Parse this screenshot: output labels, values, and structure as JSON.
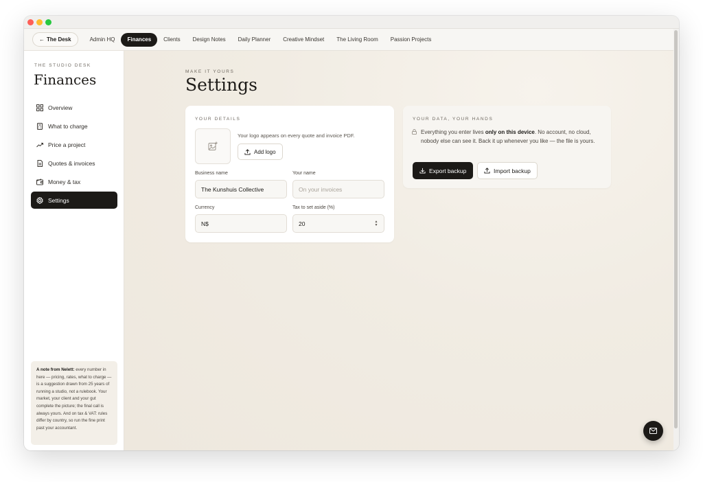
{
  "topnav": {
    "back_label": "The Desk",
    "tabs": [
      {
        "label": "Admin HQ",
        "active": false
      },
      {
        "label": "Finances",
        "active": true
      },
      {
        "label": "Clients",
        "active": false
      },
      {
        "label": "Design Notes",
        "active": false
      },
      {
        "label": "Daily Planner",
        "active": false
      },
      {
        "label": "Creative Mindset",
        "active": false
      },
      {
        "label": "The Living Room",
        "active": false
      },
      {
        "label": "Passion Projects",
        "active": false
      }
    ]
  },
  "sidebar": {
    "eyebrow": "THE STUDIO DESK",
    "title": "Finances",
    "items": [
      {
        "label": "Overview",
        "icon": "grid-icon"
      },
      {
        "label": "What to charge",
        "icon": "calculator-icon"
      },
      {
        "label": "Price a project",
        "icon": "trend-up-icon"
      },
      {
        "label": "Quotes & invoices",
        "icon": "document-icon"
      },
      {
        "label": "Money & tax",
        "icon": "wallet-icon"
      },
      {
        "label": "Settings",
        "icon": "gear-icon",
        "active": true
      }
    ],
    "note": {
      "author": "A note from Nelett:",
      "text": " every number in here — pricing, rates, what to charge — is a suggestion drawn from 25 years of running a studio, not a rulebook. Your market, your client and your gut complete the picture; the final call is always yours. And on tax & VAT: rules differ by country, so run the fine print past your accountant."
    }
  },
  "main": {
    "eyebrow": "MAKE IT YOURS",
    "title": "Settings",
    "details": {
      "eyebrow": "YOUR DETAILS",
      "logo_hint": "Your logo appears on every quote and invoice PDF.",
      "add_logo_label": "Add logo",
      "business_name_label": "Business name",
      "business_name_value": "The Kunshuis Collective",
      "your_name_label": "Your name",
      "your_name_placeholder": "On your invoices",
      "currency_label": "Currency",
      "currency_value": "N$",
      "tax_label": "Tax to set aside (%)",
      "tax_value": "20"
    },
    "data": {
      "eyebrow": "YOUR DATA, YOUR HANDS",
      "text_before": "Everything you enter lives ",
      "text_bold": "only on this device",
      "text_after": ". No account, no cloud, nobody else can see it. Back it up whenever you like — the file is yours.",
      "export_label": "Export backup",
      "import_label": "Import backup"
    }
  },
  "colors": {
    "accent_dark": "#1c1a17",
    "background": "#f3efe8",
    "traffic_red": "#fe5f57",
    "traffic_yellow": "#febc2e",
    "traffic_green": "#28c840"
  }
}
